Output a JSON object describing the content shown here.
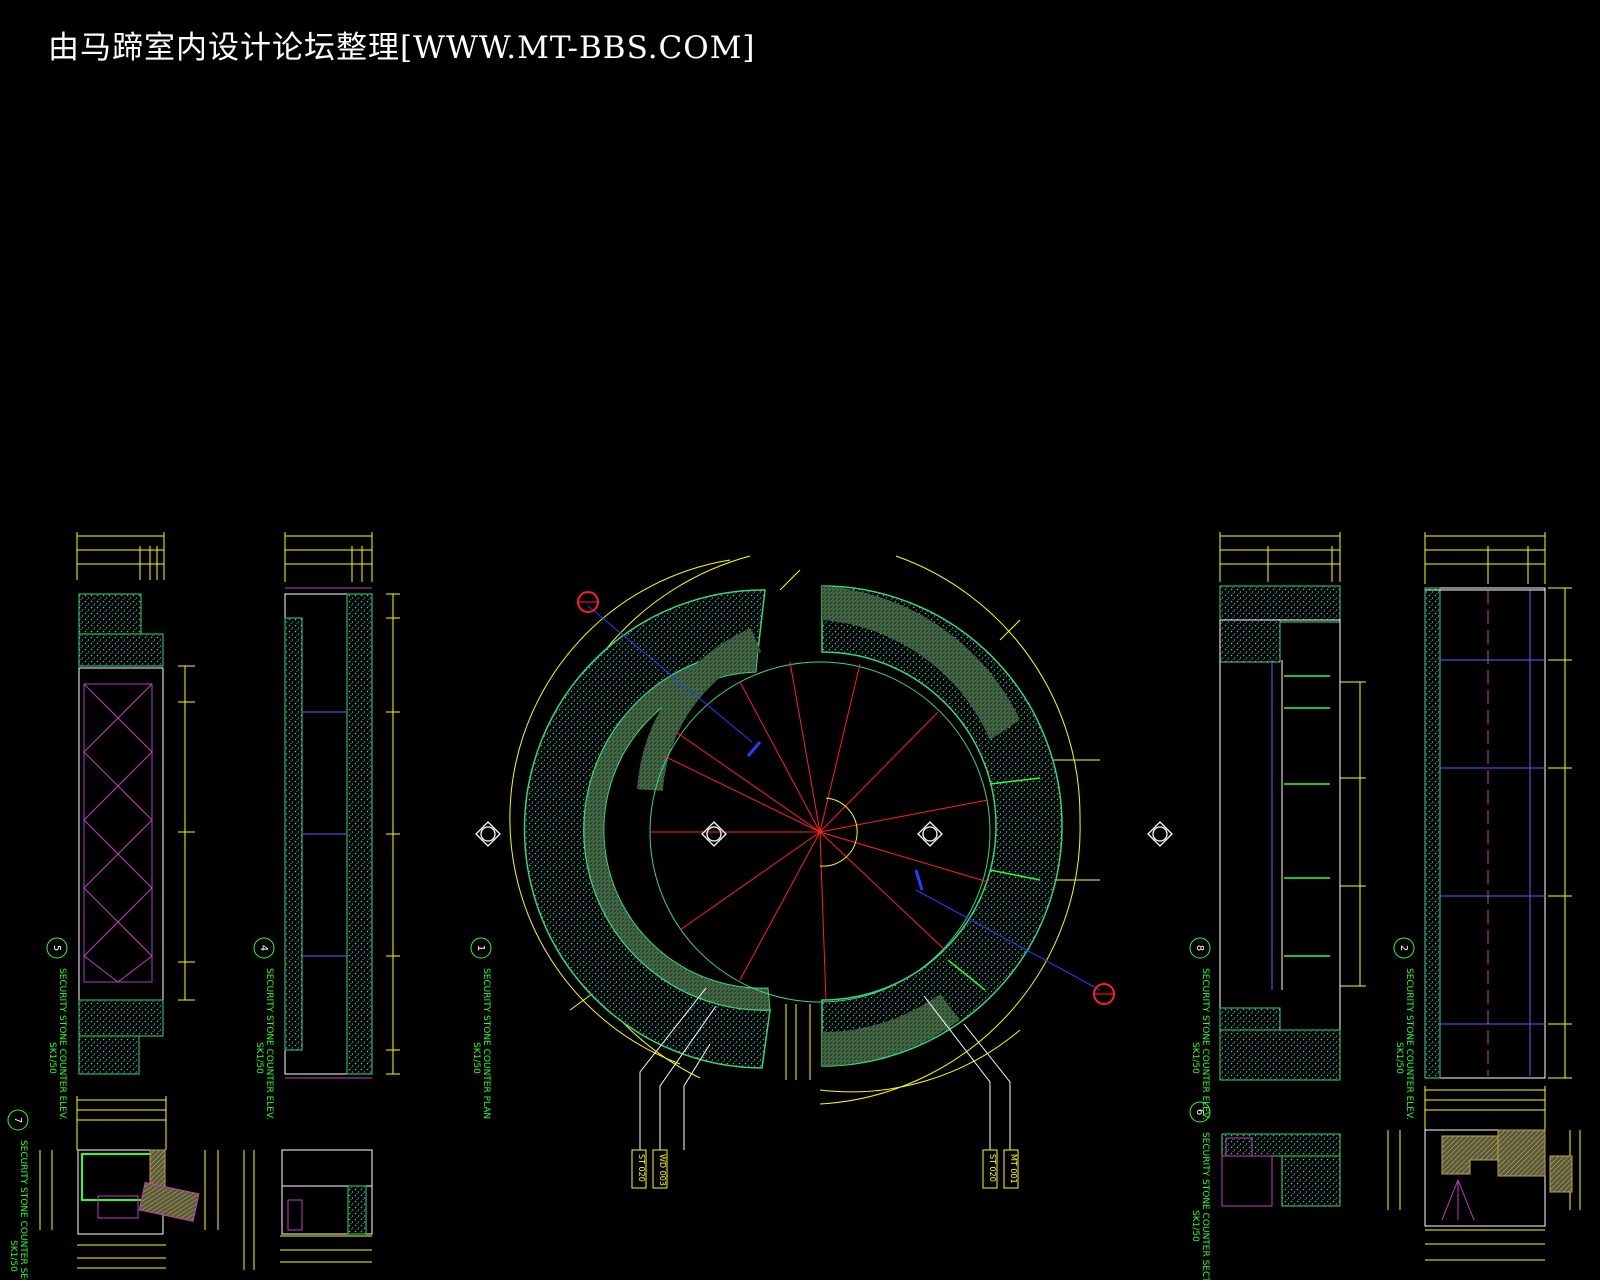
{
  "header": {
    "title": "由马蹄室内设计论坛整理[WWW.MT-BBS.COM]"
  },
  "drawings": {
    "plan": {
      "number": "1",
      "title": "SECURITY STONE COUNTER PLAN",
      "scale": "SK1/50"
    },
    "elev2": {
      "number": "2",
      "title": "SECURITY STONE COUNTER ELEV.",
      "scale": "SK1/50"
    },
    "elev4": {
      "number": "4",
      "title": "SECURITY STONE COUNTER ELEV.",
      "scale": "SK1/50"
    },
    "elev5": {
      "number": "5",
      "title": "SECURITY STONE COUNTER ELEV.",
      "scale": "SK1/50"
    },
    "sect6": {
      "number": "6",
      "title": "SECURITY STONE COUNTER SECT.",
      "scale": "SK1/50"
    },
    "sect7": {
      "number": "7",
      "title": "SECURITY STONE COUNTER SECT.",
      "scale": "SK1/50"
    },
    "elev8": {
      "number": "8",
      "title": "SECURITY STONE COUNTER ELEV.",
      "scale": "SK1/50"
    }
  },
  "material_tags": [
    "ST 020",
    "WD 003",
    "ST 020",
    "MT 001"
  ],
  "colors": {
    "background": "#000000",
    "dimension": "#ffff00",
    "stone_hatch": "#2bd96b",
    "section_cut": "#ff2020",
    "label": "#2bff2b",
    "frame": "#ffffff",
    "detail_line": "#c040c0"
  }
}
